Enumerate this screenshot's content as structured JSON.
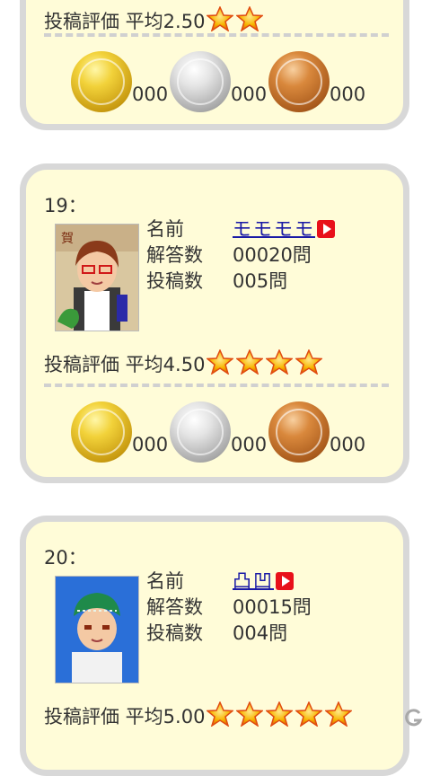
{
  "cards": [
    {
      "rating_label": "投稿評価 平均2.50",
      "stars": 2,
      "medals": {
        "gold": "000",
        "silver": "000",
        "bronze": "000"
      }
    },
    {
      "rank": "19：",
      "name_label": "名前",
      "name": "モモモモ",
      "answers_label": "解答数",
      "answers": "00020問",
      "posts_label": "投稿数",
      "posts": "005問",
      "rating_label": "投稿評価 平均4.50",
      "stars": 4,
      "medals": {
        "gold": "000",
        "silver": "000",
        "bronze": "000"
      }
    },
    {
      "rank": "20：",
      "name_label": "名前",
      "name": "凸凹",
      "answers_label": "解答数",
      "answers": "00015問",
      "posts_label": "投稿数",
      "posts": "004問",
      "rating_label": "投稿評価 平均5.00",
      "stars": 5
    }
  ],
  "icons": {
    "star": "star-icon",
    "play": "play-icon",
    "gold_medal": "gold-medal-icon",
    "silver_medal": "silver-medal-icon",
    "bronze_medal": "bronze-medal-icon"
  },
  "colors": {
    "card_bg": "#fffcd8",
    "card_border": "#d8d8d8",
    "link": "#1a1aa6",
    "play": "#e8101a",
    "star": "#f7b500"
  }
}
